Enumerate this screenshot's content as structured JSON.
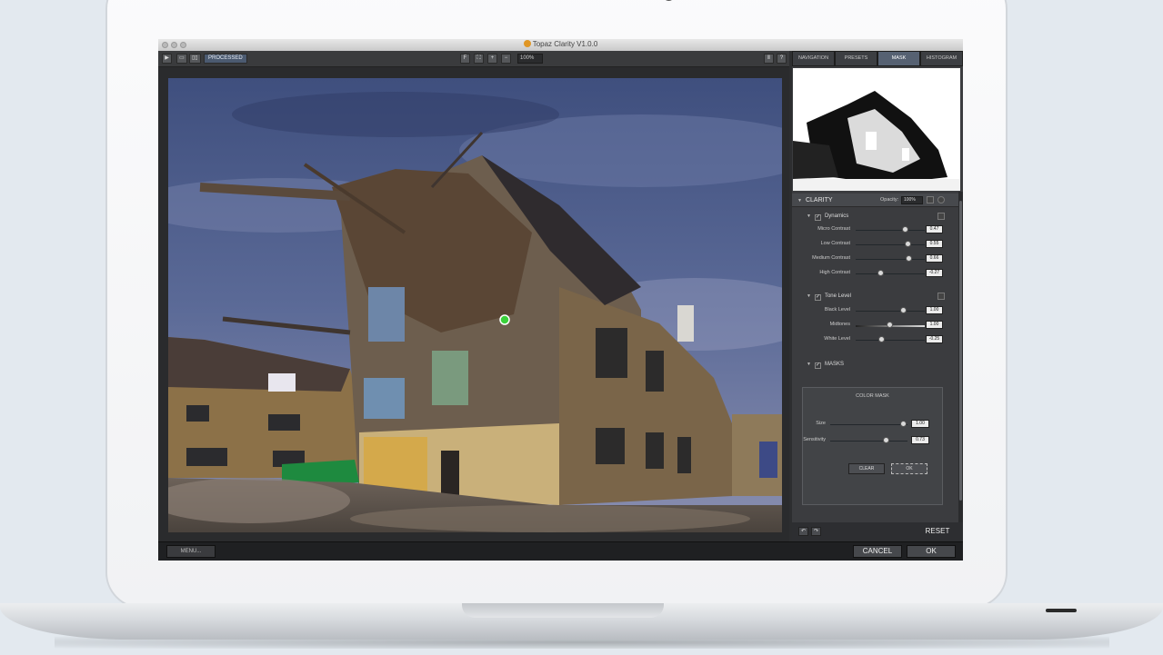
{
  "window": {
    "title": "Topaz Clarity V1.0.0"
  },
  "toolbar": {
    "view_processed_label": "PROCESSED",
    "zoom_value": "100%",
    "btn_fit": "F",
    "btn_fullscreen": "⛶",
    "btn_zoom_in": "+",
    "btn_zoom_out": "−",
    "btn_arrow": "▶",
    "btn_split_1": "▭",
    "btn_split_2": "▯▯",
    "btn_help": "?",
    "btn_pause": "Ⅱ"
  },
  "panel": {
    "tabs": [
      {
        "label": "NAVIGATION"
      },
      {
        "label": "PRESETS"
      },
      {
        "label": "MASK"
      },
      {
        "label": "HISTOGRAM"
      }
    ],
    "active_tab": "MASK",
    "clarity": {
      "title": "CLARITY",
      "opacity_label": "Opacity:",
      "opacity_value": "100%",
      "dynamics": {
        "title": "Dynamics",
        "sliders": [
          {
            "label": "Micro Contrast",
            "value": "0.47",
            "fraction": 0.72
          },
          {
            "label": "Low Contrast",
            "value": "0.55",
            "fraction": 0.76
          },
          {
            "label": "Medium Contrast",
            "value": "0.66",
            "fraction": 0.78
          },
          {
            "label": "High Contrast",
            "value": "-0.27",
            "fraction": 0.37
          }
        ]
      },
      "tone_level": {
        "title": "Tone Level",
        "sliders": [
          {
            "label": "Black Level",
            "value": "1.00",
            "fraction": 0.7
          },
          {
            "label": "Midtones",
            "value": "1.00",
            "fraction": 0.5
          },
          {
            "label": "White Level",
            "value": "-0.25",
            "fraction": 0.38
          }
        ]
      },
      "masks": {
        "title": "MASKS",
        "color_mask_title": "COLOR MASK",
        "sliders": [
          {
            "label": "Size",
            "value": "1.00",
            "fraction": 0.95
          },
          {
            "label": "Sensitivity",
            "value": "0.73",
            "fraction": 0.73
          }
        ],
        "clear_label": "CLEAR",
        "ok_label": "OK"
      }
    },
    "reset_label": "RESET",
    "undo_icon": "↶",
    "redo_icon": "↷"
  },
  "bottom": {
    "menu_label": "MENU...",
    "cancel_label": "CANCEL",
    "ok_label": "OK"
  },
  "colors": {
    "active_tab": "#566172",
    "panel_bg": "#3b3c3f",
    "mask_point": "#3ad13a"
  }
}
